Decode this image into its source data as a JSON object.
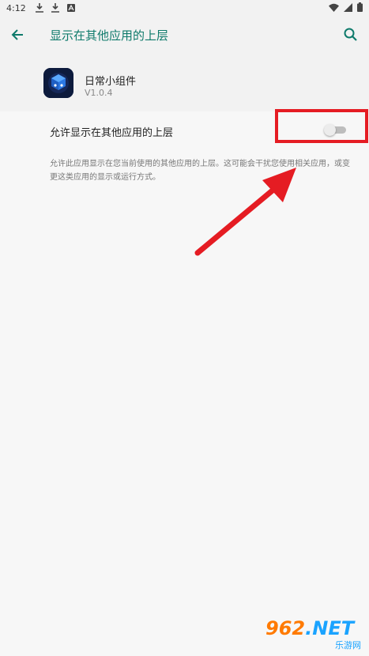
{
  "status_bar": {
    "time": "4:12"
  },
  "app_bar": {
    "title": "显示在其他应用的上层"
  },
  "app": {
    "name": "日常小组件",
    "version": "V1.0.4"
  },
  "permission": {
    "label": "允许显示在其他应用的上层",
    "enabled": false,
    "description": "允许此应用显示在您当前使用的其他应用的上层。这可能会干扰您使用相关应用，或变更这类应用的显示或运行方式。"
  },
  "watermark": {
    "top": "962",
    "net": ".NET",
    "bottom": "乐游网"
  },
  "icons": [
    "download-icon",
    "download-icon",
    "app-notification-icon",
    "wifi-icon",
    "signal-icon",
    "battery-icon",
    "back-arrow-icon",
    "search-icon",
    "toggle-switch"
  ],
  "colors": {
    "accent": "#0e7a6b",
    "highlight": "#e51c23",
    "background": "#f7f7f7"
  }
}
